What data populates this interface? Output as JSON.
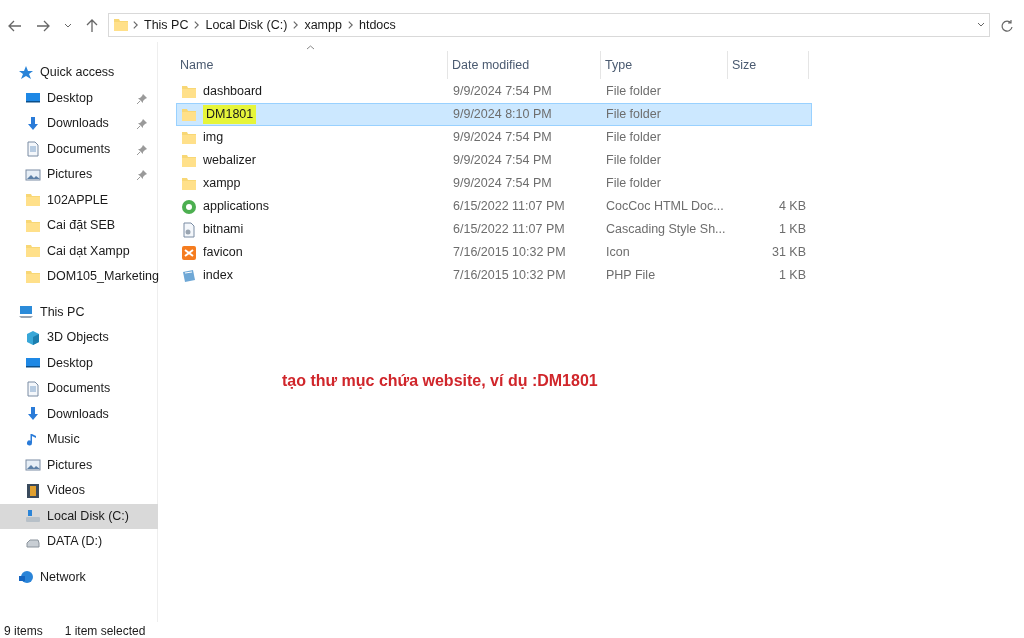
{
  "address_bar": {
    "breadcrumbs": [
      "This PC",
      "Local Disk (C:)",
      "xampp",
      "htdocs"
    ]
  },
  "sidebar": {
    "sections": [
      {
        "label": "Quick access",
        "kind": "star",
        "children": [
          {
            "label": "Desktop",
            "kind": "desktop",
            "pinned": true,
            "selected": false
          },
          {
            "label": "Downloads",
            "kind": "download",
            "pinned": true,
            "selected": false
          },
          {
            "label": "Documents",
            "kind": "document",
            "pinned": true,
            "selected": false
          },
          {
            "label": "Pictures",
            "kind": "pictures",
            "pinned": true,
            "selected": false
          },
          {
            "label": "102APPLE",
            "kind": "folder",
            "pinned": false,
            "selected": false
          },
          {
            "label": "Cai đặt SEB",
            "kind": "folder",
            "pinned": false,
            "selected": false
          },
          {
            "label": "Cai dạt Xampp",
            "kind": "folder",
            "pinned": false,
            "selected": false
          },
          {
            "label": "DOM105_Marketing",
            "kind": "folder",
            "pinned": false,
            "selected": false
          }
        ]
      },
      {
        "label": "This PC",
        "kind": "pc",
        "children": [
          {
            "label": "3D Objects",
            "kind": "cube",
            "pinned": false,
            "selected": false
          },
          {
            "label": "Desktop",
            "kind": "desktop",
            "pinned": false,
            "selected": false
          },
          {
            "label": "Documents",
            "kind": "document",
            "pinned": false,
            "selected": false
          },
          {
            "label": "Downloads",
            "kind": "download",
            "pinned": false,
            "selected": false
          },
          {
            "label": "Music",
            "kind": "music",
            "pinned": false,
            "selected": false
          },
          {
            "label": "Pictures",
            "kind": "pictures",
            "pinned": false,
            "selected": false
          },
          {
            "label": "Videos",
            "kind": "video",
            "pinned": false,
            "selected": false
          },
          {
            "label": "Local Disk (C:)",
            "kind": "disk",
            "pinned": false,
            "selected": true
          },
          {
            "label": "DATA (D:)",
            "kind": "drive",
            "pinned": false,
            "selected": false
          }
        ]
      },
      {
        "label": "Network",
        "kind": "network"
      }
    ]
  },
  "table": {
    "columns": [
      "Name",
      "Date modified",
      "Type",
      "Size"
    ],
    "rows": [
      {
        "name": "dashboard",
        "date": "9/9/2024 7:54 PM",
        "type": "File folder",
        "kind": "folder",
        "selected": false,
        "highlighted": false
      },
      {
        "name": "DM1801",
        "date": "9/9/2024 8:10 PM",
        "type": "File folder",
        "kind": "folder",
        "selected": true,
        "highlighted": true
      },
      {
        "name": "img",
        "date": "9/9/2024 7:54 PM",
        "type": "File folder",
        "kind": "folder",
        "selected": false,
        "highlighted": false
      },
      {
        "name": "webalizer",
        "date": "9/9/2024 7:54 PM",
        "type": "File folder",
        "kind": "folder",
        "selected": false,
        "highlighted": false
      },
      {
        "name": "xampp",
        "date": "9/9/2024 7:54 PM",
        "type": "File folder",
        "kind": "folder",
        "selected": false,
        "highlighted": false
      },
      {
        "name": "applications",
        "date": "6/15/2022 11:07 PM",
        "type": "CocCoc HTML Doc...",
        "size": "4 KB",
        "kind": "browser",
        "selected": false,
        "highlighted": false
      },
      {
        "name": "bitnami",
        "date": "6/15/2022 11:07 PM",
        "type": "Cascading Style Sh...",
        "size": "1 KB",
        "kind": "stylesheet",
        "selected": false,
        "highlighted": false
      },
      {
        "name": "favicon",
        "date": "7/16/2015 10:32 PM",
        "type": "Icon",
        "size": "31 KB",
        "kind": "favicon",
        "selected": false,
        "highlighted": false
      },
      {
        "name": "index",
        "date": "7/16/2015 10:32 PM",
        "type": "PHP File",
        "size": "1 KB",
        "kind": "php",
        "selected": false,
        "highlighted": false
      }
    ]
  },
  "annotation": "tạo thư mục chứa website, ví dụ :DM1801",
  "status_bar": [
    "9 items",
    "1 item selected"
  ]
}
